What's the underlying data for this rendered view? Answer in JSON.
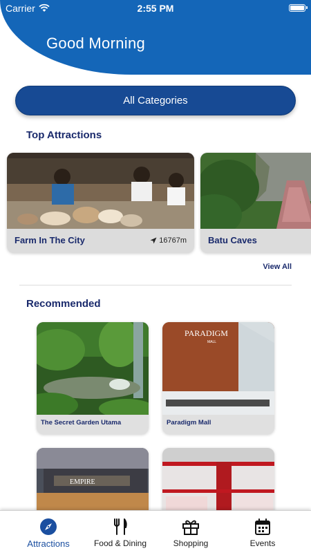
{
  "status_bar": {
    "carrier": "Carrier",
    "time": "2:55 PM"
  },
  "header": {
    "greeting": "Good Morning"
  },
  "category_button": {
    "label": "All Categories"
  },
  "top_attractions": {
    "title": "Top Attractions",
    "view_all": "View All",
    "items": [
      {
        "name": "Farm In The City",
        "distance": "16767m"
      },
      {
        "name": "Batu Caves"
      }
    ]
  },
  "recommended": {
    "title": "Recommended",
    "items": [
      {
        "name": "The Secret Garden Utama"
      },
      {
        "name": "Paradigm Mall"
      },
      {
        "name": ""
      },
      {
        "name": ""
      }
    ]
  },
  "tab_bar": {
    "tabs": [
      {
        "label": "Attractions",
        "icon": "compass-icon",
        "active": true
      },
      {
        "label": "Food & Dining",
        "icon": "fork-knife-icon",
        "active": false
      },
      {
        "label": "Shopping",
        "icon": "gift-icon",
        "active": false
      },
      {
        "label": "Events",
        "icon": "calendar-icon",
        "active": false
      }
    ]
  },
  "colors": {
    "primary": "#1466b8",
    "button": "#174a94",
    "heading": "#1a2a6c"
  }
}
